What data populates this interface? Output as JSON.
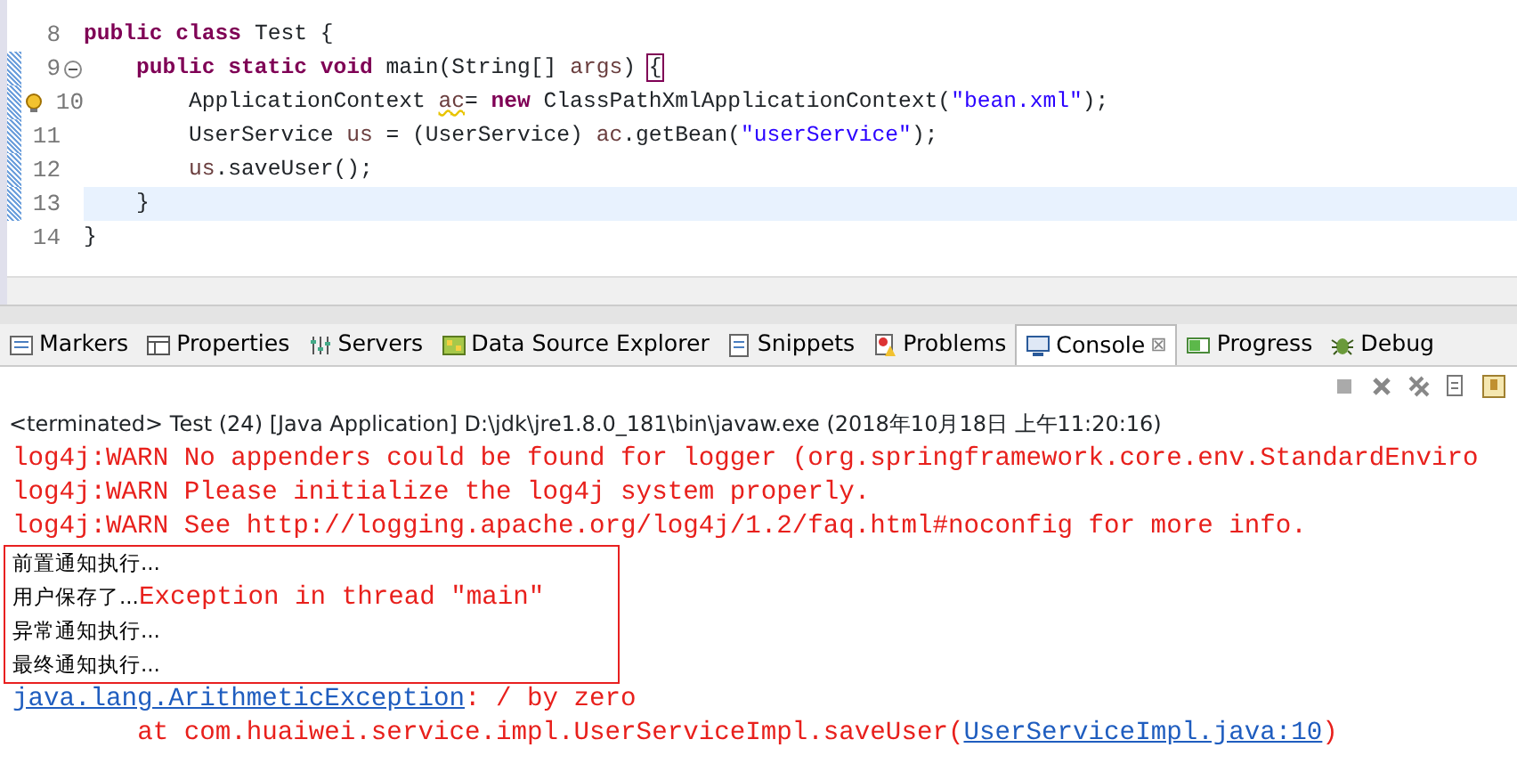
{
  "editor": {
    "lines": [
      {
        "number": "8",
        "current": false,
        "changed": false,
        "warning": false,
        "foldable": false,
        "tokens": [
          {
            "kind": "kw",
            "text": "public class"
          },
          {
            "kind": "text",
            "text": " Test {"
          }
        ]
      },
      {
        "number": "9",
        "current": false,
        "changed": true,
        "warning": false,
        "foldable": true,
        "tokens": [
          {
            "kind": "kw",
            "text": "    public static void"
          },
          {
            "kind": "text",
            "text": " main(String[] "
          },
          {
            "kind": "local",
            "text": "args"
          },
          {
            "kind": "text",
            "text": ") "
          },
          {
            "kind": "bracket",
            "text": "{"
          }
        ]
      },
      {
        "number": "10",
        "current": false,
        "changed": true,
        "warning": true,
        "foldable": false,
        "tokens": [
          {
            "kind": "text",
            "text": "        ApplicationContext "
          },
          {
            "kind": "warnlocal",
            "text": "ac"
          },
          {
            "kind": "text",
            "text": "= "
          },
          {
            "kind": "kw",
            "text": "new"
          },
          {
            "kind": "text",
            "text": " ClassPathXmlApplicationContext("
          },
          {
            "kind": "str",
            "text": "\"bean.xml\""
          },
          {
            "kind": "text",
            "text": ");"
          }
        ]
      },
      {
        "number": "11",
        "current": false,
        "changed": true,
        "warning": false,
        "foldable": false,
        "tokens": [
          {
            "kind": "text",
            "text": "        UserService "
          },
          {
            "kind": "local",
            "text": "us"
          },
          {
            "kind": "text",
            "text": " = (UserService) "
          },
          {
            "kind": "local",
            "text": "ac"
          },
          {
            "kind": "text",
            "text": ".getBean("
          },
          {
            "kind": "str",
            "text": "\"userService\""
          },
          {
            "kind": "text",
            "text": ");"
          }
        ]
      },
      {
        "number": "12",
        "current": false,
        "changed": true,
        "warning": false,
        "foldable": false,
        "tokens": [
          {
            "kind": "local",
            "text": "        us"
          },
          {
            "kind": "text",
            "text": ".saveUser();"
          }
        ]
      },
      {
        "number": "13",
        "current": true,
        "changed": true,
        "warning": false,
        "foldable": false,
        "tokens": [
          {
            "kind": "text",
            "text": "    }"
          }
        ]
      },
      {
        "number": "14",
        "current": false,
        "changed": false,
        "warning": false,
        "foldable": false,
        "tokens": [
          {
            "kind": "text",
            "text": "}"
          }
        ]
      }
    ]
  },
  "tabs": [
    {
      "label": "Markers",
      "selected": false
    },
    {
      "label": "Properties",
      "selected": false
    },
    {
      "label": "Servers",
      "selected": false
    },
    {
      "label": "Data Source Explorer",
      "selected": false
    },
    {
      "label": "Snippets",
      "selected": false
    },
    {
      "label": "Problems",
      "selected": false
    },
    {
      "label": "Console",
      "selected": true,
      "close": "⊠"
    },
    {
      "label": "Progress",
      "selected": false
    },
    {
      "label": "Debug",
      "selected": false
    }
  ],
  "console": {
    "header": "<terminated> Test (24) [Java Application] D:\\jdk\\jre1.8.0_181\\bin\\javaw.exe (2018年10月18日 上午11:20:16)",
    "lines": [
      {
        "boxed": false,
        "segments": [
          {
            "kind": "err",
            "text": "log4j:WARN No appenders could be found for logger (org.springframework.core.env.StandardEnviro"
          }
        ]
      },
      {
        "boxed": false,
        "segments": [
          {
            "kind": "err",
            "text": "log4j:WARN Please initialize the log4j system properly."
          }
        ]
      },
      {
        "boxed": false,
        "segments": [
          {
            "kind": "err",
            "text": "log4j:WARN See http://logging.apache.org/log4j/1.2/faq.html#noconfig for more info."
          }
        ]
      },
      {
        "boxed": true,
        "segments": [
          {
            "kind": "out",
            "text": "前置通知执行..."
          }
        ]
      },
      {
        "boxed": true,
        "segments": [
          {
            "kind": "out",
            "text": "用户保存了..."
          },
          {
            "kind": "err",
            "text": "Exception in thread \"main\""
          }
        ]
      },
      {
        "boxed": true,
        "segments": [
          {
            "kind": "out",
            "text": "异常通知执行..."
          }
        ]
      },
      {
        "boxed": true,
        "segments": [
          {
            "kind": "out",
            "text": "最终通知执行..."
          }
        ]
      },
      {
        "boxed": false,
        "segments": [
          {
            "kind": "link",
            "text": "java.lang.ArithmeticException"
          },
          {
            "kind": "err",
            "text": ": / by zero"
          }
        ]
      },
      {
        "boxed": false,
        "segments": [
          {
            "kind": "err",
            "text": "\tat com.huaiwei.service.impl.UserServiceImpl.saveUser("
          },
          {
            "kind": "link",
            "text": "UserServiceImpl.java:10"
          },
          {
            "kind": "err",
            "text": ")"
          }
        ]
      }
    ]
  }
}
